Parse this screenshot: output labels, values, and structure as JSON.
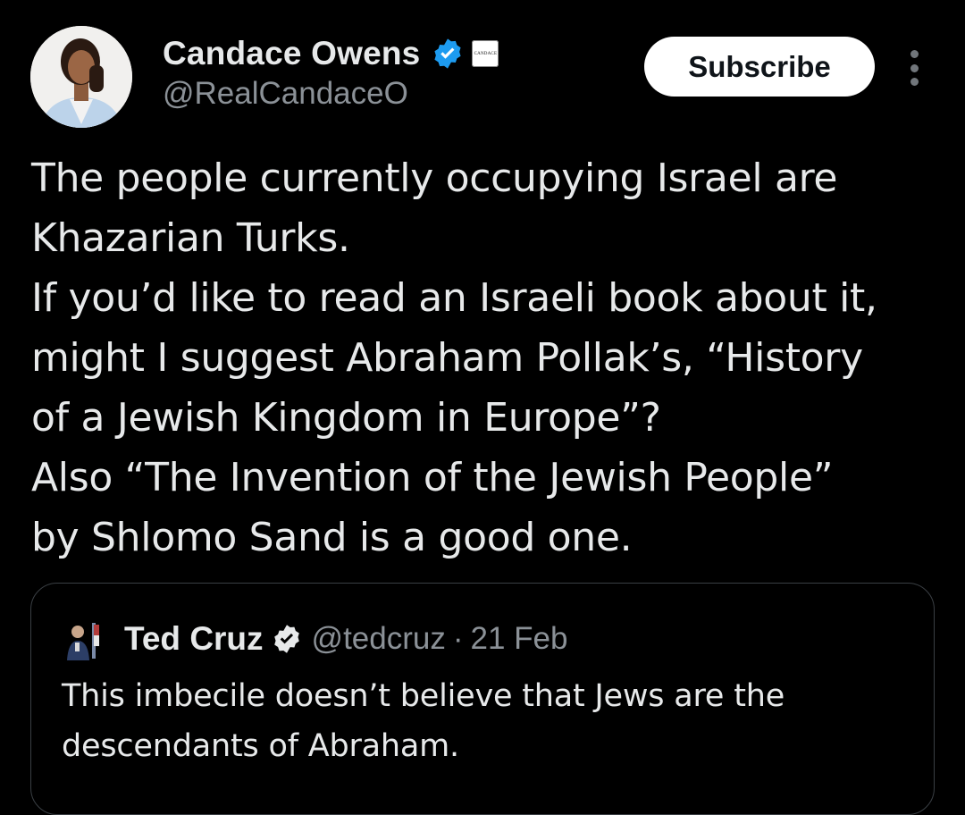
{
  "author": {
    "display_name": "Candace Owens",
    "handle": "@RealCandaceO",
    "verified": true,
    "affiliate_badge_icon": "candace-affiliate-badge-icon",
    "affiliate_badge_text": "CANDACE",
    "avatar_icon": "profile-photo-avatar"
  },
  "actions": {
    "subscribe_label": "Subscribe",
    "more_icon": "more-vertical-icon"
  },
  "tweet": {
    "text": "The people currently occupying Israel are\nKhazarian Turks.\nIf you’d like to read an Israeli book about it,\nmight I suggest Abraham Pollak’s, “History\nof a Jewish Kingdom in Europe”?\nAlso “The Invention of the Jewish People”\nby Shlomo Sand is a good one."
  },
  "quoted_tweet": {
    "display_name": "Ted Cruz",
    "handle": "@tedcruz",
    "separator": "·",
    "date": "21 Feb",
    "verified": true,
    "text": "This imbecile doesn’t believe that Jews are the\ndescendants of Abraham.",
    "avatar_icon": "profile-photo-avatar"
  },
  "colors": {
    "background": "#000000",
    "text_primary": "#e7e9ea",
    "text_secondary": "#8b9197",
    "verified_blue": "#1d9bf0",
    "quote_border": "#3a3f44",
    "subscribe_bg": "#ffffff"
  }
}
